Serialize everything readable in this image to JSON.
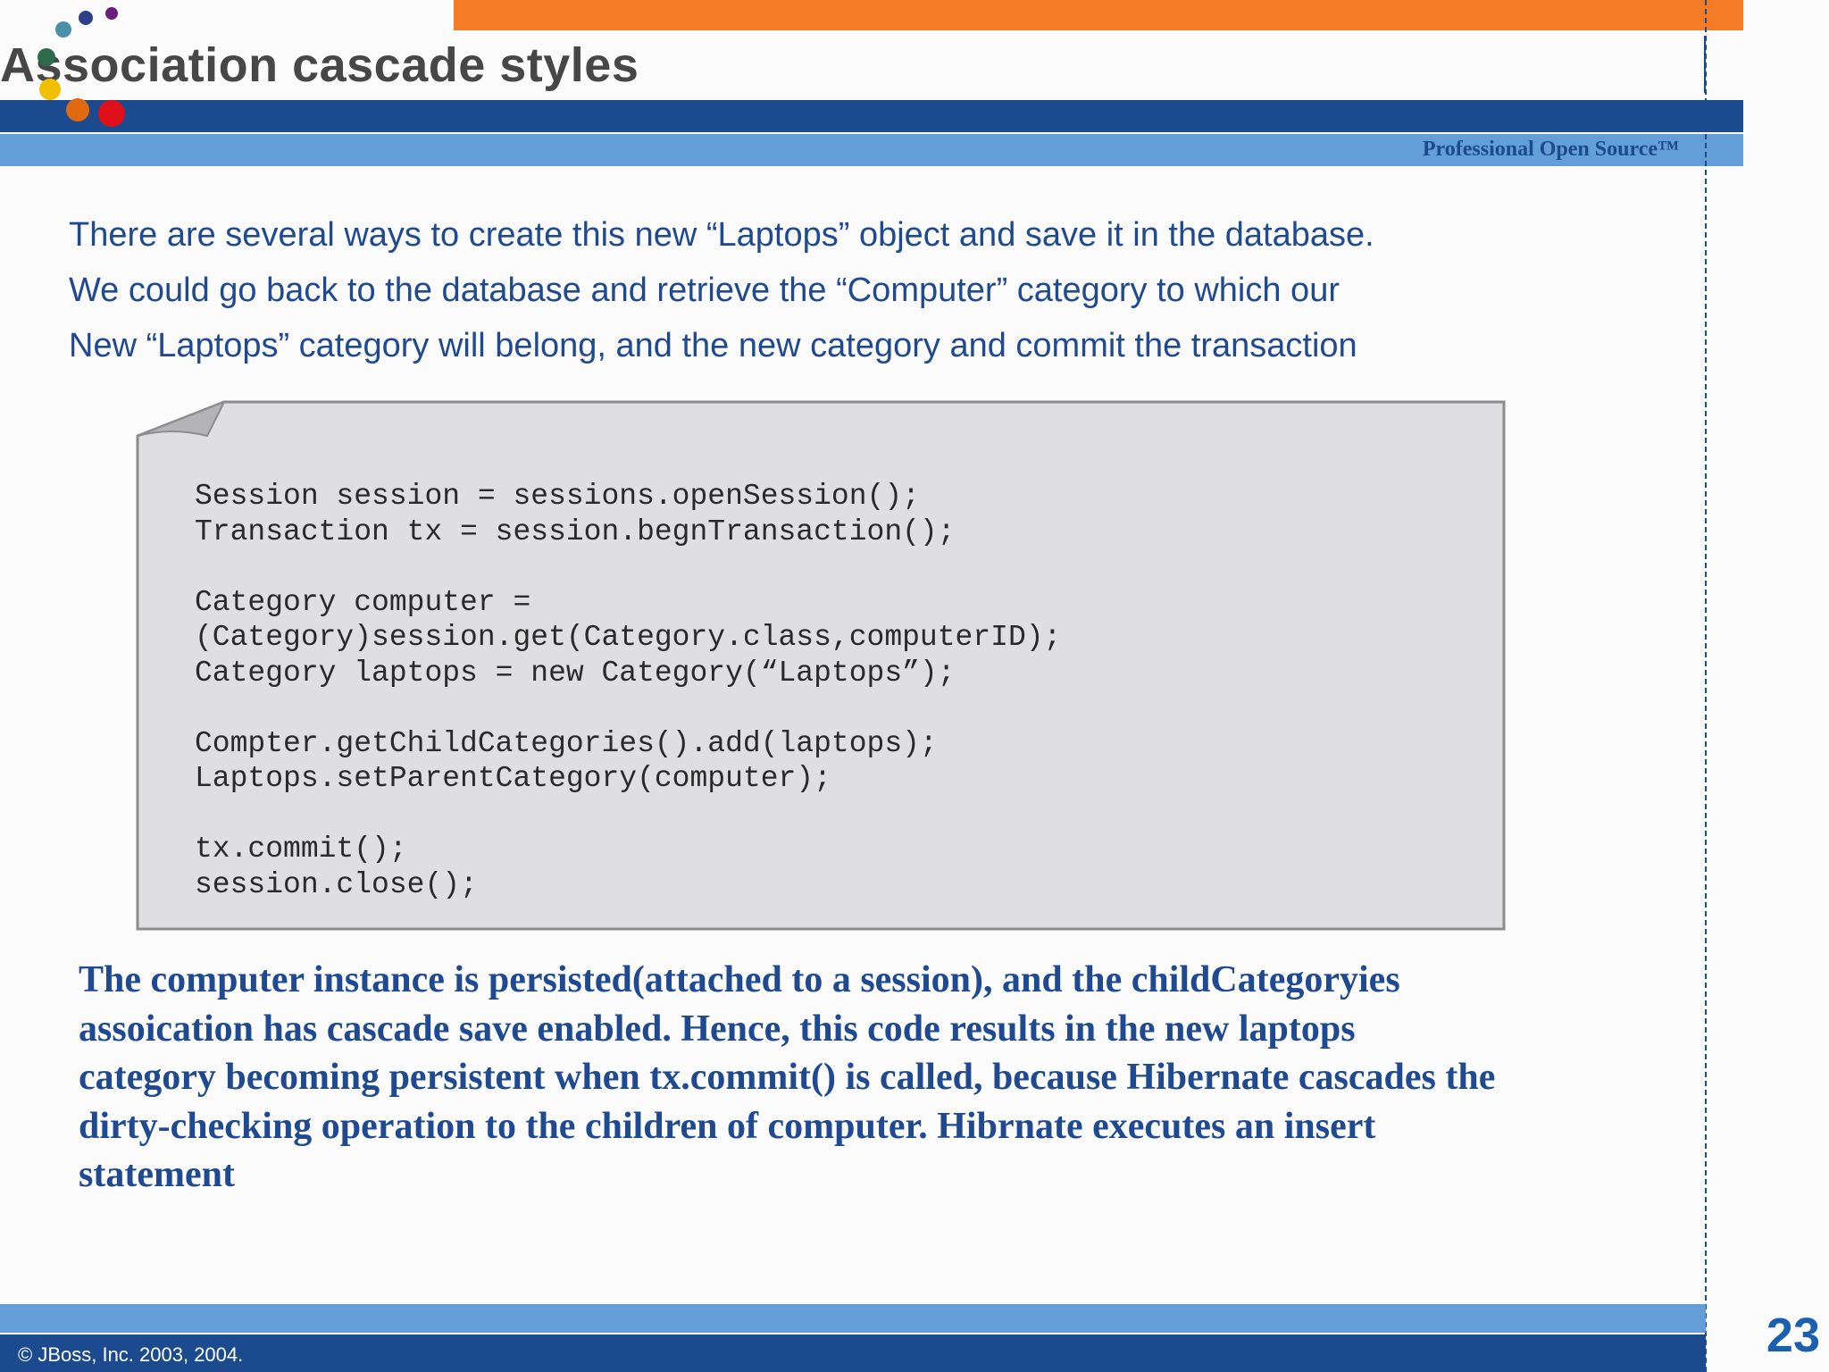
{
  "slide": {
    "title": "Association cascade styles",
    "tagline": "Professional Open Source™",
    "intro_lines": [
      "There are several ways to create this new “Laptops” object and save it in the database.",
      "We could go back to the database and retrieve the “Computer” category to which our",
      "New “Laptops” category will belong, and the new category and commit the transaction"
    ],
    "code_lines": [
      "Session session = sessions.openSession();",
      "Transaction tx = session.begnTransaction();",
      "",
      "Category computer =",
      "(Category)session.get(Category.class,computerID);",
      "Category laptops = new Category(“Laptops”);",
      "",
      "Compter.getChildCategories().add(laptops);",
      "Laptops.setParentCategory(computer);",
      "",
      "tx.commit();",
      "session.close();"
    ],
    "conclusion_lines": [
      "The computer instance is persisted(attached to a session), and the childCategoryies",
      "assoication has cascade save enabled. Hence, this code results in the new laptops",
      "category becoming persistent when tx.commit() is called, because Hibernate cascades the",
      "dirty-checking operation to the children of computer. Hibrnate executes an insert",
      "statement"
    ],
    "copyright": "© JBoss, Inc. 2003, 2004.",
    "page_number": "23"
  },
  "colors": {
    "orange": "#f57b26",
    "navy": "#1b4a8e",
    "light_blue": "#649ed8",
    "text_blue": "#1f4a92",
    "logo_dots": [
      "#4c8fa8",
      "#2e3f8a",
      "#6b1e7a",
      "#2f6b4a",
      "#f0c000",
      "#e06a10",
      "#e0101a"
    ]
  }
}
